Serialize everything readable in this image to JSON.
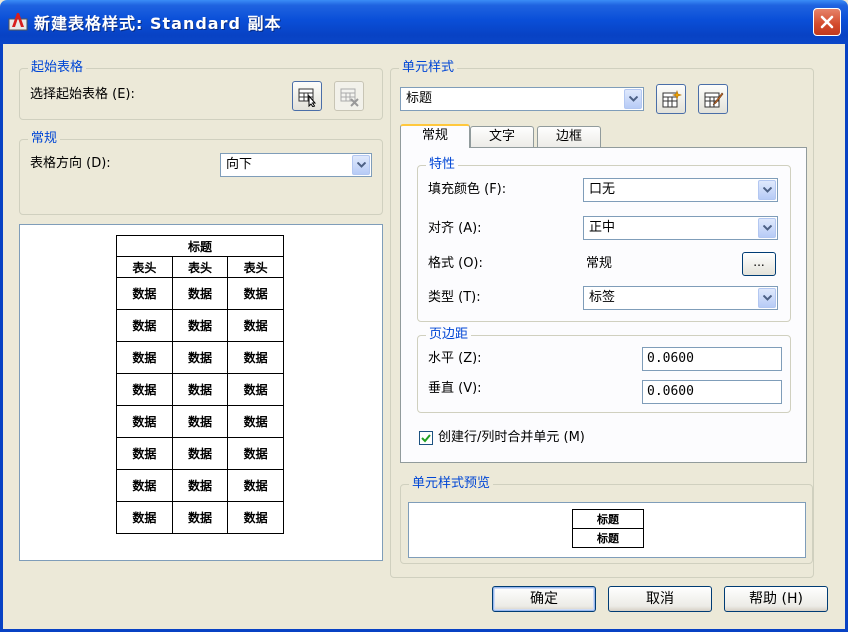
{
  "window": {
    "title": "新建表格样式: Standard 副本",
    "title_color": "#0a4fd8"
  },
  "start_table": {
    "legend": "起始表格",
    "select_label": "选择起始表格 (E):"
  },
  "general": {
    "legend": "常规",
    "direction_label": "表格方向 (D):",
    "direction_value": "向下"
  },
  "table_preview": {
    "title": "标题",
    "headers": [
      "表头",
      "表头",
      "表头"
    ],
    "cell": "数据",
    "rows": 8
  },
  "cell_style": {
    "legend": "单元样式",
    "selected": "标题",
    "tabs": [
      "常规",
      "文字",
      "边框"
    ]
  },
  "properties": {
    "legend": "特性",
    "fill_label": "填充颜色 (F):",
    "fill_value": "口无",
    "align_label": "对齐 (A):",
    "align_value": "正中",
    "format_label": "格式 (O):",
    "format_value": "常规",
    "format_button": "...",
    "type_label": "类型 (T):",
    "type_value": "标签"
  },
  "margins": {
    "legend": "页边距",
    "horizontal_label": "水平 (Z):",
    "horizontal_value": "0.0600",
    "vertical_label": "垂直 (V):",
    "vertical_value": "0.0600"
  },
  "merge_checkbox": {
    "label": "创建行/列时合并单元 (M)",
    "checked": true
  },
  "cell_preview": {
    "legend": "单元样式预览",
    "cells": [
      "标题",
      "标题"
    ]
  },
  "buttons": {
    "ok": "确定",
    "cancel": "取消",
    "help": "帮助 (H)"
  }
}
